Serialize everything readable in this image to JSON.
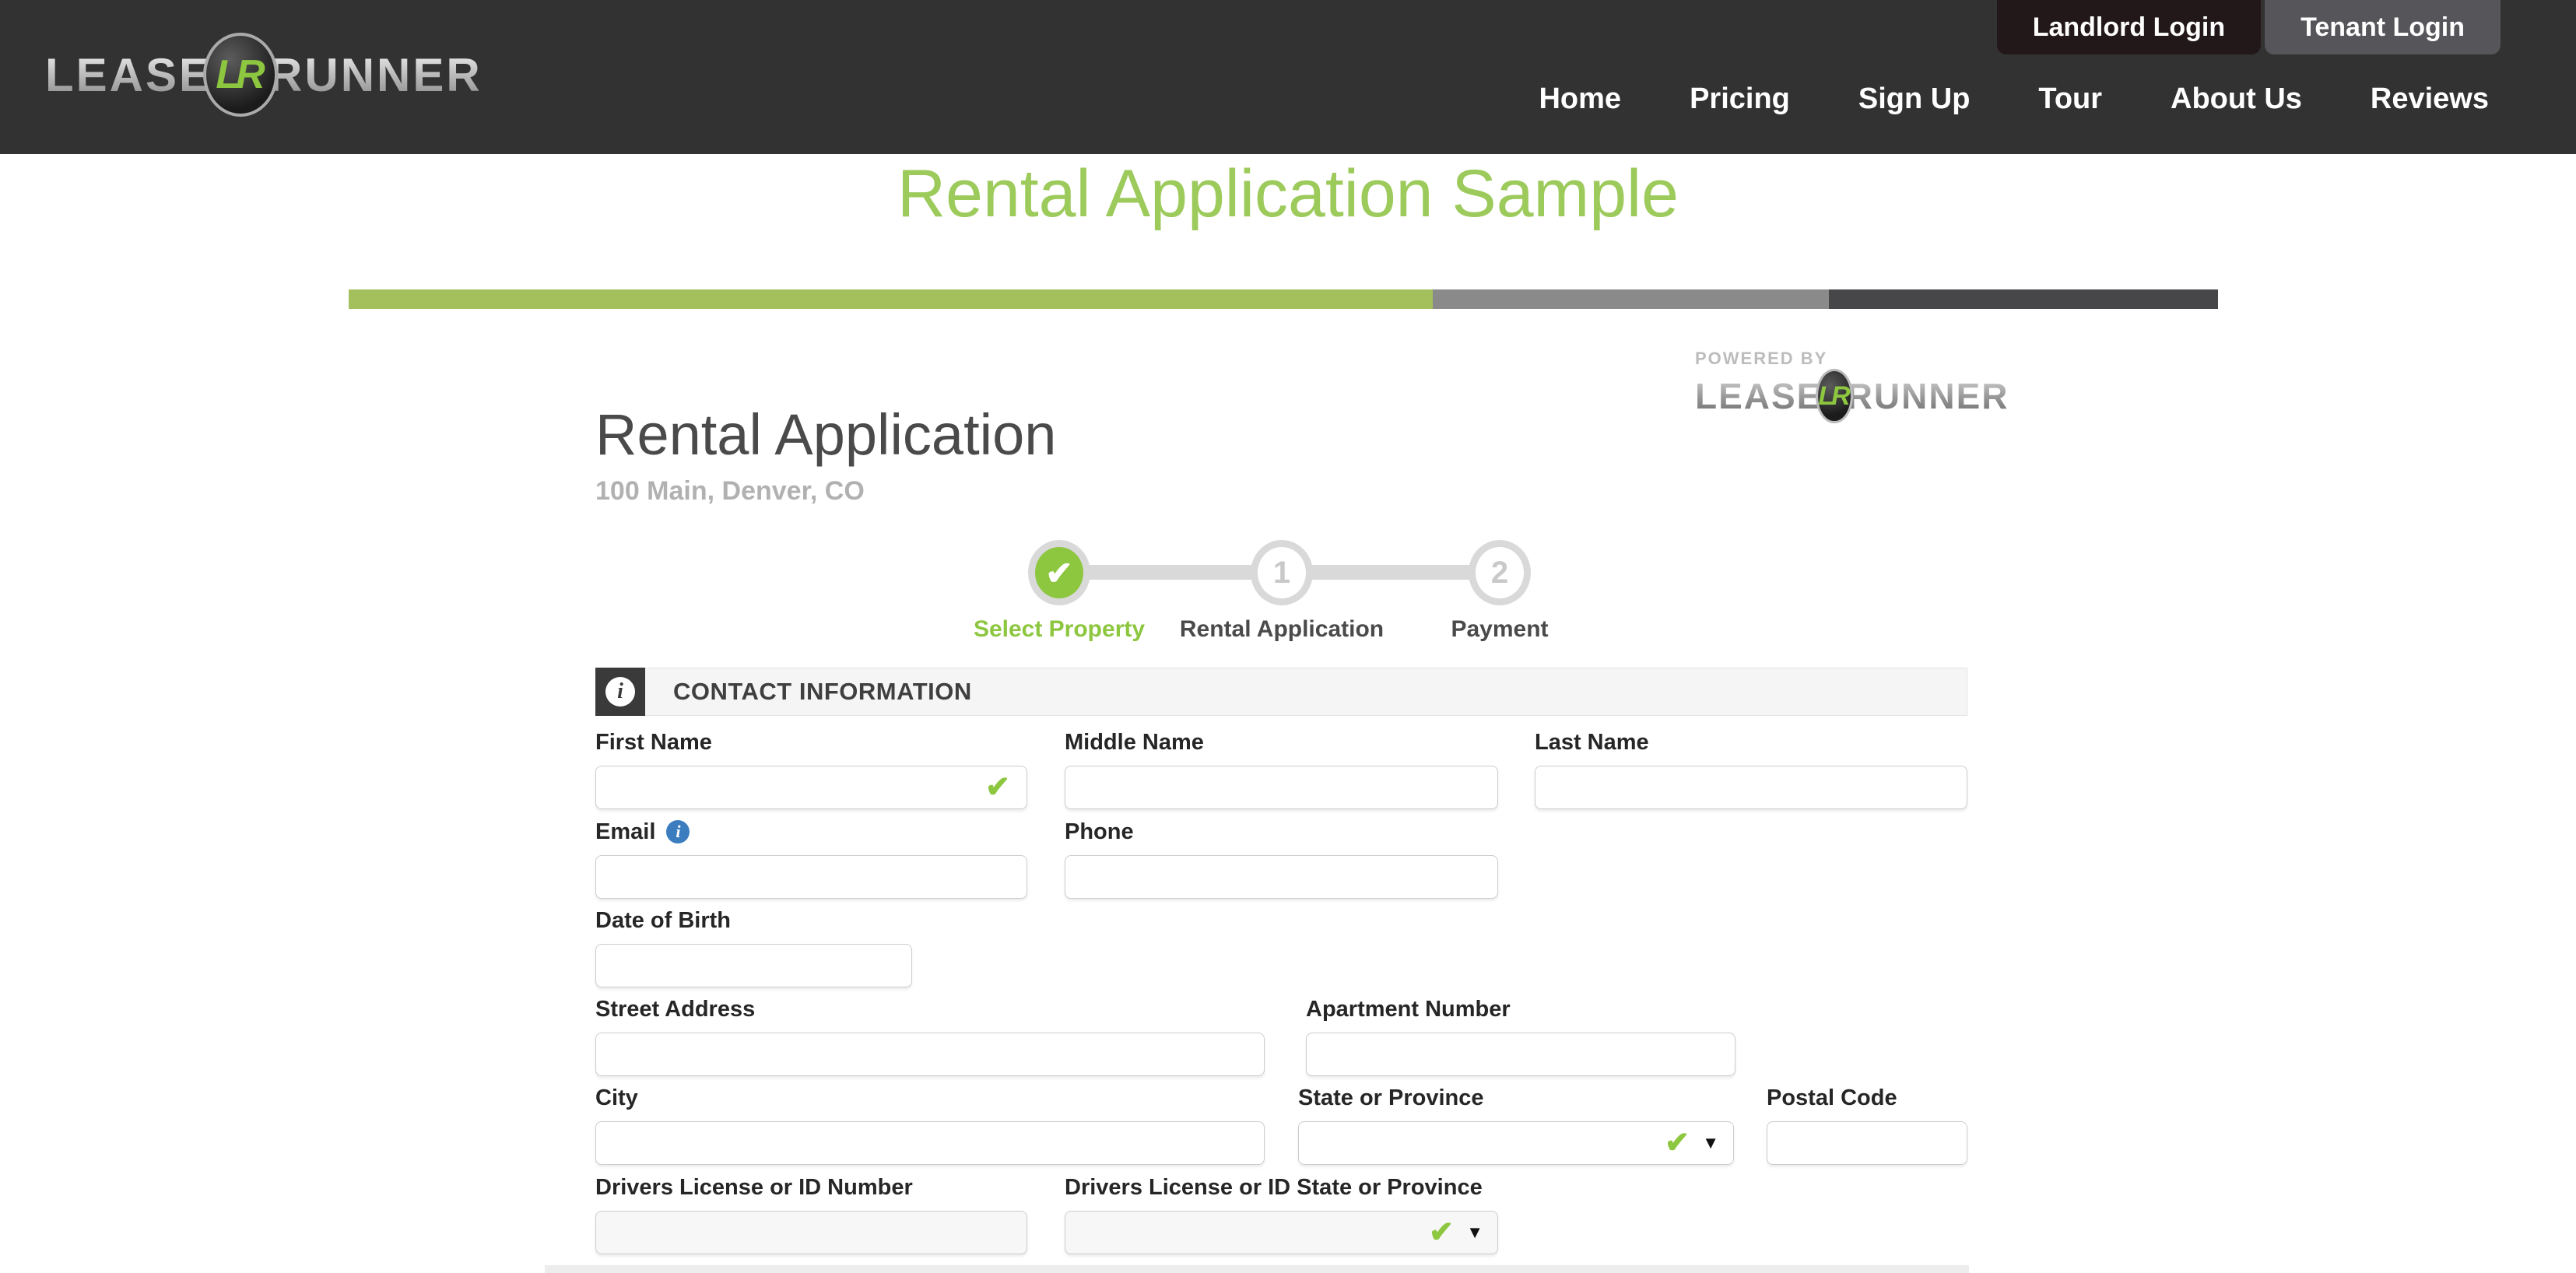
{
  "nav": {
    "logo": {
      "lease": "LEASE",
      "runner": "RUNNER",
      "emblem": "LR"
    },
    "login_buttons": [
      {
        "label": "Landlord Login"
      },
      {
        "label": "Tenant Login"
      }
    ],
    "links": [
      "Home",
      "Pricing",
      "Sign Up",
      "Tour",
      "About Us",
      "Reviews"
    ]
  },
  "page": {
    "title": "Rental Application Sample",
    "progress": {
      "segments": [
        {
          "name": "complete",
          "pct": 58,
          "color": "#a3c05c"
        },
        {
          "name": "current",
          "pct": 21.2,
          "color": "#8a8a8a"
        },
        {
          "name": "remaining",
          "pct": 20.8,
          "color": "#47474a"
        }
      ]
    },
    "powered_by": {
      "label": "POWERED BY",
      "lease": "LEASE",
      "runner": "RUNNER",
      "emblem": "LR"
    }
  },
  "application": {
    "heading": "Rental Application",
    "property": "100 Main, Denver, CO",
    "steps": [
      {
        "label": "Select Property",
        "state": "complete"
      },
      {
        "label": "Rental Application",
        "number": "1",
        "state": "pending"
      },
      {
        "label": "Payment",
        "number": "2",
        "state": "pending"
      }
    ],
    "section": {
      "title": "CONTACT INFORMATION"
    },
    "fields": {
      "first_name": {
        "label": "First Name",
        "value": "",
        "valid": true
      },
      "middle_name": {
        "label": "Middle Name",
        "value": ""
      },
      "last_name": {
        "label": "Last Name",
        "value": ""
      },
      "email": {
        "label": "Email",
        "value": "",
        "has_info": true
      },
      "phone": {
        "label": "Phone",
        "value": ""
      },
      "dob": {
        "label": "Date of Birth",
        "value": ""
      },
      "street": {
        "label": "Street Address",
        "value": ""
      },
      "apt": {
        "label": "Apartment Number",
        "value": ""
      },
      "city": {
        "label": "City",
        "value": ""
      },
      "state": {
        "label": "State or Province",
        "value": "",
        "valid": true
      },
      "postal": {
        "label": "Postal Code",
        "value": ""
      },
      "dl_number": {
        "label": "Drivers License or ID Number",
        "value": ""
      },
      "dl_state": {
        "label": "Drivers License or ID State or Province",
        "value": "",
        "valid": true
      }
    }
  },
  "icons": {
    "check": "✔",
    "dropdown_arrow": "▼",
    "info": "i"
  },
  "colors": {
    "navbar": "#323232",
    "brand_green": "#8dc63f",
    "title_green": "#9cca5b",
    "progress_green": "#a3c05c",
    "progress_gray": "#8a8a8a",
    "progress_dark": "#47474a"
  }
}
